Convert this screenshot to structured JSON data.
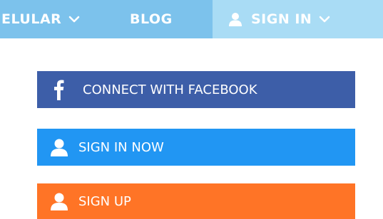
{
  "nav": {
    "cellular_label": "ELULAR",
    "blog_label": "BLOG",
    "signin_label": "SIGN IN"
  },
  "buttons": {
    "facebook_label": "CONNECT WITH FACEBOOK",
    "signin_now_label": "SIGN IN NOW",
    "signup_label": "SIGN UP"
  },
  "colors": {
    "nav_bg": "#7cc2ec",
    "nav_active_bg": "#a9dcf5",
    "facebook": "#3d5ea8",
    "signin": "#2196f3",
    "signup": "#ff7426"
  },
  "icons": {
    "nav_chevron": "chevron-down-icon",
    "user": "user-icon",
    "facebook": "facebook-icon"
  }
}
